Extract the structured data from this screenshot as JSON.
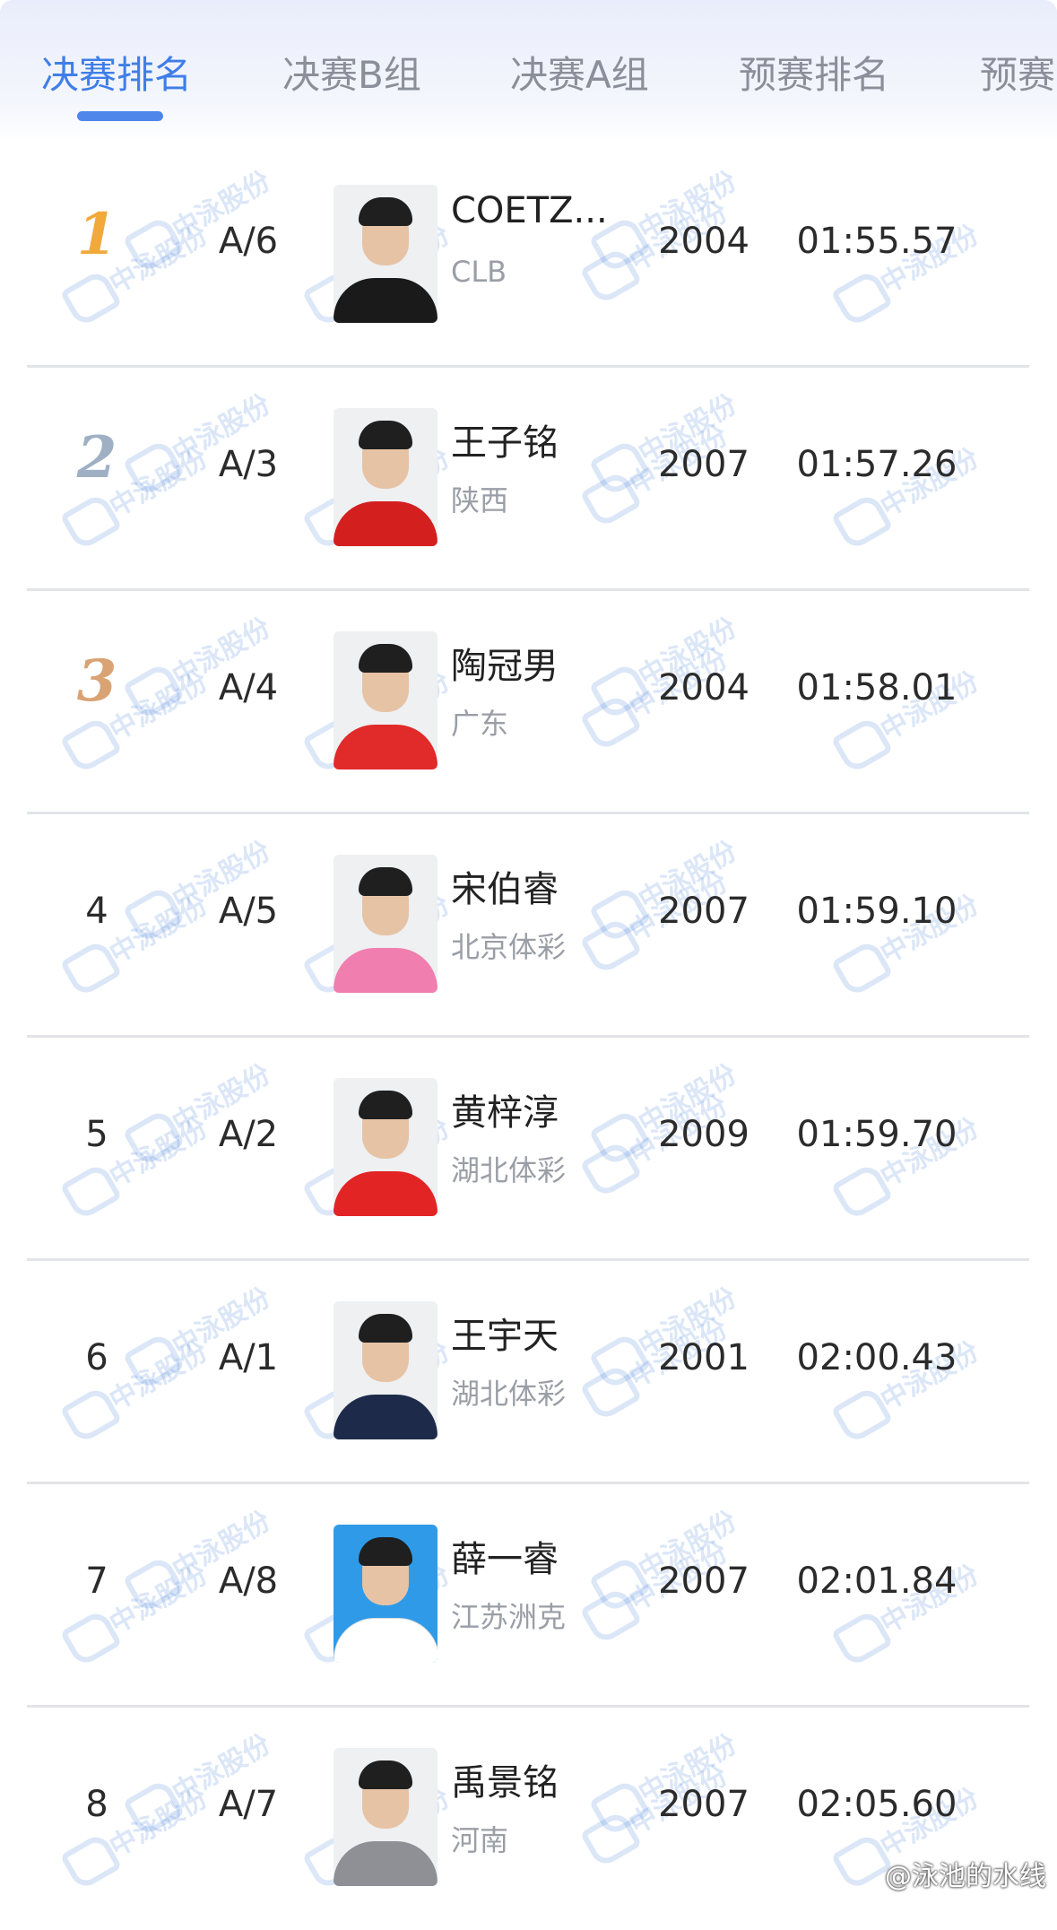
{
  "tabs": [
    {
      "label": "决赛排名",
      "active": true
    },
    {
      "label": "决赛B组",
      "active": false
    },
    {
      "label": "决赛A组",
      "active": false
    },
    {
      "label": "预赛排名",
      "active": false
    },
    {
      "label": "预赛",
      "active": false
    }
  ],
  "watermark_text": "中泳股份",
  "rows": [
    {
      "rank": "1",
      "medal": "gold",
      "lane": "A/6",
      "name": "COETZ...",
      "team": "CLB",
      "year": "2004",
      "time": "01:55.57",
      "shirt": "#1a1a1a"
    },
    {
      "rank": "2",
      "medal": "silver",
      "lane": "A/3",
      "name": "王子铭",
      "team": "陕西",
      "year": "2007",
      "time": "01:57.26",
      "shirt": "#d41f1f"
    },
    {
      "rank": "3",
      "medal": "bronze",
      "lane": "A/4",
      "name": "陶冠男",
      "team": "广东",
      "year": "2004",
      "time": "01:58.01",
      "shirt": "#e12a2a"
    },
    {
      "rank": "4",
      "medal": "",
      "lane": "A/5",
      "name": "宋伯睿",
      "team": "北京体彩",
      "year": "2007",
      "time": "01:59.10",
      "shirt": "#f07fb0"
    },
    {
      "rank": "5",
      "medal": "",
      "lane": "A/2",
      "name": "黄梓淳",
      "team": "湖北体彩",
      "year": "2009",
      "time": "01:59.70",
      "shirt": "#e32424"
    },
    {
      "rank": "6",
      "medal": "",
      "lane": "A/1",
      "name": "王宇天",
      "team": "湖北体彩",
      "year": "2001",
      "time": "02:00.43",
      "shirt": "#1d2a4a"
    },
    {
      "rank": "7",
      "medal": "",
      "lane": "A/8",
      "name": "薛一睿",
      "team": "江苏洲克",
      "year": "2007",
      "time": "02:01.84",
      "shirt": "#ffffff"
    },
    {
      "rank": "8",
      "medal": "",
      "lane": "A/7",
      "name": "禹景铭",
      "team": "河南",
      "year": "2007",
      "time": "02:05.60",
      "shirt": "#8e9096"
    }
  ],
  "colors": {
    "accent": "#3f7ee8",
    "gold": "#f0a93a",
    "silver": "#9fb0c4",
    "bronze": "#d9a374"
  },
  "credit": "@泳池的水线"
}
